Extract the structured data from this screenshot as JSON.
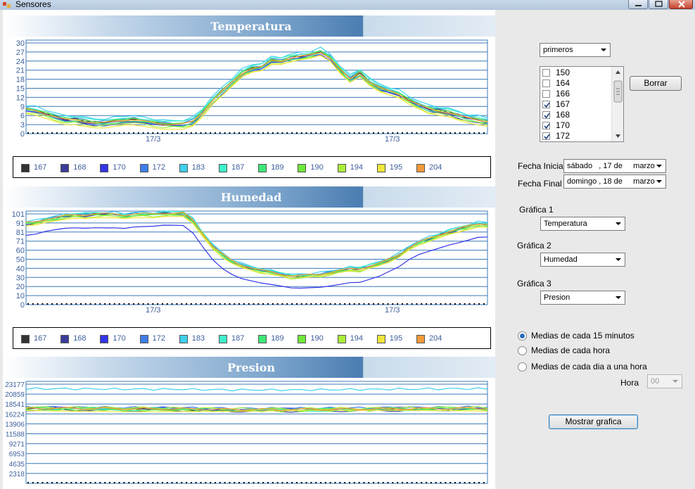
{
  "window": {
    "title": "Sensores"
  },
  "charts": [
    {
      "title": "Temperatura",
      "yticks": [
        "30",
        "27",
        "24",
        "21",
        "18",
        "15",
        "12",
        "9",
        "6",
        "3",
        "0"
      ],
      "xticks": [
        "17/3",
        "17/3"
      ],
      "legend": [
        "167",
        "168",
        "170",
        "172",
        "183",
        "187",
        "189",
        "190",
        "194",
        "195",
        "204"
      ]
    },
    {
      "title": "Humedad",
      "yticks": [
        "101",
        "91",
        "81",
        "71",
        "60",
        "50",
        "40",
        "30",
        "20",
        "10",
        "0"
      ],
      "xticks": [
        "17/3",
        "17/3"
      ],
      "legend": [
        "167",
        "168",
        "170",
        "172",
        "183",
        "187",
        "189",
        "190",
        "194",
        "195",
        "204"
      ]
    },
    {
      "title": "Presion",
      "yticks": [
        "23177",
        "20859",
        "18541",
        "16224",
        "13906",
        "11588",
        "9271",
        "6953",
        "4635",
        "2318"
      ],
      "xticks": [],
      "legend": []
    }
  ],
  "series_colors": [
    "#333333",
    "#3c3c9a",
    "#3434e8",
    "#3f7fe8",
    "#3ed0ee",
    "#3ef0cc",
    "#3ee878",
    "#6ee83a",
    "#aaee3a",
    "#f0e63a",
    "#f59a3a"
  ],
  "chart_data": [
    {
      "type": "line",
      "title": "Temperatura",
      "ylim": [
        0,
        31
      ],
      "xtick_labels": [
        "17/3",
        "17/3"
      ],
      "x": [
        0,
        1,
        2,
        3,
        4,
        5,
        6,
        7,
        8,
        9,
        10,
        11,
        12,
        13,
        14,
        15,
        16,
        17,
        18,
        19,
        20,
        21,
        22,
        23,
        24,
        25,
        26,
        27,
        28,
        29,
        30,
        31,
        32,
        33,
        34,
        35,
        36,
        37,
        38,
        39,
        40,
        41,
        42,
        43,
        44,
        45,
        46,
        47
      ],
      "base": [
        8,
        7.5,
        6.5,
        5.5,
        4.5,
        4.5,
        4,
        3.5,
        3.5,
        4,
        4.5,
        4.5,
        4,
        3.5,
        3,
        3,
        3,
        4,
        7,
        11,
        14,
        17,
        20,
        21.5,
        22,
        24,
        24,
        25,
        25.5,
        26,
        27,
        25,
        21,
        18,
        20,
        17,
        15,
        14,
        13,
        11,
        9.5,
        8,
        7.5,
        7,
        6,
        5,
        4.5,
        4
      ],
      "series": [
        {
          "name": "167",
          "offset": 0.3
        },
        {
          "name": "168",
          "offset": -0.2
        },
        {
          "name": "170",
          "offset": -0.6
        },
        {
          "name": "172",
          "offset": 0.6
        },
        {
          "name": "183",
          "offset": 1.4
        },
        {
          "name": "187",
          "offset": 0.9
        },
        {
          "name": "189",
          "offset": -0.3
        },
        {
          "name": "190",
          "offset": 0.4
        },
        {
          "name": "194",
          "offset": -0.9
        },
        {
          "name": "195",
          "offset": -1.3
        },
        {
          "name": "204",
          "offset": 0.1
        }
      ]
    },
    {
      "type": "line",
      "title": "Humedad",
      "ylim": [
        0,
        106
      ],
      "xtick_labels": [
        "17/3",
        "17/3"
      ],
      "x": [
        0,
        1,
        2,
        3,
        4,
        5,
        6,
        7,
        8,
        9,
        10,
        11,
        12,
        13,
        14,
        15,
        16,
        17,
        18,
        19,
        20,
        21,
        22,
        23,
        24,
        25,
        26,
        27,
        28,
        29,
        30,
        31,
        32,
        33,
        34,
        35,
        36,
        37,
        38,
        39,
        40,
        41,
        42,
        43,
        44,
        45,
        46,
        47
      ],
      "base": [
        92,
        93,
        96,
        98,
        100,
        101,
        101,
        102,
        102,
        102,
        101,
        102,
        102,
        102,
        103,
        103,
        103,
        95,
        80,
        66,
        56,
        49,
        44,
        41,
        38,
        36,
        34,
        32,
        32,
        33,
        34,
        36,
        38,
        40,
        40,
        43,
        46,
        51,
        56,
        64,
        70,
        74,
        78,
        82,
        85,
        88,
        91,
        91
      ],
      "series": [
        {
          "name": "167",
          "offset": 0.5
        },
        {
          "name": "168",
          "offset": -0.5
        },
        {
          "name": "170",
          "offset": -14
        },
        {
          "name": "172",
          "offset": 1.2
        },
        {
          "name": "183",
          "offset": 2.5
        },
        {
          "name": "187",
          "offset": 1.5
        },
        {
          "name": "189",
          "offset": -1
        },
        {
          "name": "190",
          "offset": 0
        },
        {
          "name": "194",
          "offset": -2
        },
        {
          "name": "195",
          "offset": -2.5
        },
        {
          "name": "204",
          "offset": 0.8
        }
      ]
    },
    {
      "type": "line",
      "title": "Presion",
      "ylim": [
        0,
        25000
      ],
      "x": [
        0,
        1,
        2,
        3,
        4,
        5,
        6,
        7,
        8,
        9,
        10,
        11,
        12,
        13,
        14,
        15,
        16,
        17,
        18,
        19,
        20,
        21,
        22,
        23,
        24,
        25,
        26,
        27,
        28,
        29,
        30,
        31,
        32,
        33,
        34,
        35,
        36,
        37,
        38,
        39,
        40,
        41,
        42,
        43,
        44,
        45,
        46,
        47
      ],
      "base": [
        18300,
        18300,
        18300,
        18300,
        18300,
        18250,
        18250,
        18250,
        18250,
        18200,
        18200,
        18200,
        18200,
        18150,
        18150,
        18150,
        18150,
        18100,
        18100,
        18050,
        18050,
        18000,
        18000,
        18000,
        18000,
        18000,
        18000,
        18000,
        18000,
        18050,
        18050,
        18050,
        18100,
        18100,
        18100,
        18150,
        18150,
        18200,
        18200,
        18200,
        18250,
        18250,
        18250,
        18300,
        18300,
        18300,
        18300,
        18300
      ],
      "series": [
        {
          "name": "167",
          "offset": 0
        },
        {
          "name": "168",
          "offset": -300
        },
        {
          "name": "170",
          "offset": 200
        },
        {
          "name": "172",
          "offset": 400
        },
        {
          "name": "183",
          "offset": 4900
        },
        {
          "name": "187",
          "offset": -150
        },
        {
          "name": "189",
          "offset": 150
        },
        {
          "name": "190",
          "offset": -250
        },
        {
          "name": "194",
          "offset": 300
        },
        {
          "name": "195",
          "offset": -400
        },
        {
          "name": "204",
          "offset": 100
        }
      ]
    }
  ],
  "controls": {
    "filter_select": "primeros",
    "sensor_list": [
      {
        "label": "150",
        "checked": false
      },
      {
        "label": "164",
        "checked": false
      },
      {
        "label": "166",
        "checked": false
      },
      {
        "label": "167",
        "checked": true
      },
      {
        "label": "168",
        "checked": true
      },
      {
        "label": "170",
        "checked": true
      },
      {
        "label": "172",
        "checked": true
      }
    ],
    "borrar_label": "Borrar",
    "fecha_inicial_label": "Fecha Inicial",
    "fecha_inicial_value": "sábado   , 17 de     marzo",
    "fecha_final_label": "Fecha Final",
    "fecha_final_value": "domingo , 18 de     marzo",
    "grafica1_label": "Gráfica 1",
    "grafica1_value": "Temperatura",
    "grafica2_label": "Gráfica 2",
    "grafica2_value": "Humedad",
    "grafica3_label": "Gráfica 3",
    "grafica3_value": "Presion",
    "radio_options": [
      "Medias de cada 15 minutos",
      "Medias de cada hora",
      "Medias de cada dia a una hora"
    ],
    "radio_selected": 0,
    "hora_label": "Hora",
    "hora_value": "00",
    "mostrar_label": "Mostrar grafica"
  }
}
